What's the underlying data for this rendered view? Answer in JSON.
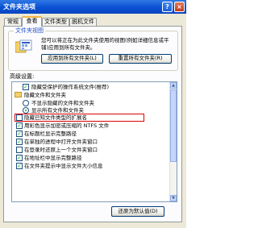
{
  "window": {
    "title": "文件夹选项",
    "help_label": "?",
    "close_label": "×"
  },
  "tabs": [
    {
      "label": "常规"
    },
    {
      "label": "查看"
    },
    {
      "label": "文件类型"
    },
    {
      "label": "脱机文件"
    }
  ],
  "folder_views": {
    "legend": "文件夹视图",
    "description": "您可以将正在为此文件夹使用的视图(例如详细信息或平铺)应用到所有文件夹。",
    "apply_all_label": "应用到所有文件夹(L)",
    "reset_all_label": "重置所有文件夹(R)"
  },
  "advanced": {
    "label": "高级设置:",
    "items": [
      {
        "type": "check",
        "checked": true,
        "label": "隐藏受保护的操作系统文件(推荐)"
      },
      {
        "type": "folder",
        "label": "隐藏文件和文件夹"
      },
      {
        "type": "radio",
        "selected": false,
        "label": "不显示隐藏的文件和文件夹"
      },
      {
        "type": "radio",
        "selected": true,
        "label": "显示所有文件和文件夹"
      },
      {
        "type": "check",
        "checked": false,
        "label": "隐藏已知文件类型的扩展名"
      },
      {
        "type": "check",
        "checked": true,
        "label": "用彩色显示加密或压缩的 NTFS 文件"
      },
      {
        "type": "check",
        "checked": true,
        "label": "在标题栏显示完整路径"
      },
      {
        "type": "check",
        "checked": true,
        "label": "在单独的进程中打开文件夹窗口"
      },
      {
        "type": "check",
        "checked": false,
        "label": "在登录时还原上一个文件夹窗口"
      },
      {
        "type": "check",
        "checked": true,
        "label": "在地址栏中显示完整路径"
      },
      {
        "type": "check",
        "checked": true,
        "label": "在文件夹提示中显示文件大小信息"
      }
    ],
    "restore_defaults_label": "还原为默认值(D)"
  },
  "colors": {
    "title_bar": "#0a51d4",
    "highlight_border": "#e00000",
    "active_tab_accent": "#f5b543"
  }
}
